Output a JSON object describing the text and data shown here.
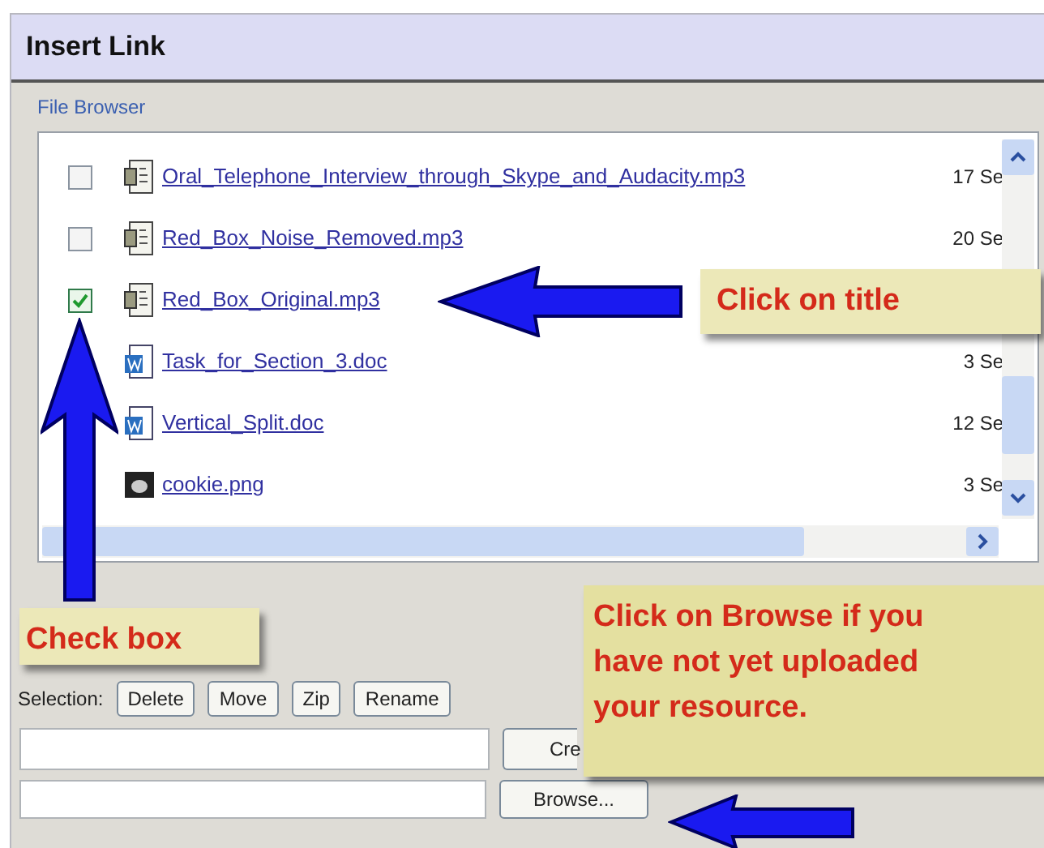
{
  "window": {
    "title": "Insert Link"
  },
  "section_title": "File Browser",
  "files": [
    {
      "kind": "audio",
      "checked": false,
      "name": "Oral_Telephone_Interview_through_Skype_and_Audacity.mp3",
      "date": "17 Se"
    },
    {
      "kind": "audio",
      "checked": false,
      "name": "Red_Box_Noise_Removed.mp3",
      "date": "20 Se"
    },
    {
      "kind": "audio",
      "checked": true,
      "name": "Red_Box_Original.mp3"
    },
    {
      "kind": "document",
      "name": "Task_for_Section_3.doc",
      "date": "3 Se"
    },
    {
      "kind": "document",
      "name": "Vertical_Split.doc",
      "date": "12 Se"
    },
    {
      "kind": "image",
      "name": "cookie.png",
      "date": "3 Se"
    }
  ],
  "selection": {
    "label": "Selection:",
    "buttons": [
      "Delete",
      "Move",
      "Zip",
      "Rename"
    ]
  },
  "folder_row": {
    "button": "Cre"
  },
  "upload_row": {
    "button": "Browse..."
  },
  "callouts": [
    "Click on title",
    "Check box",
    "Click on Browse if you have not yet uploaded your resource."
  ]
}
